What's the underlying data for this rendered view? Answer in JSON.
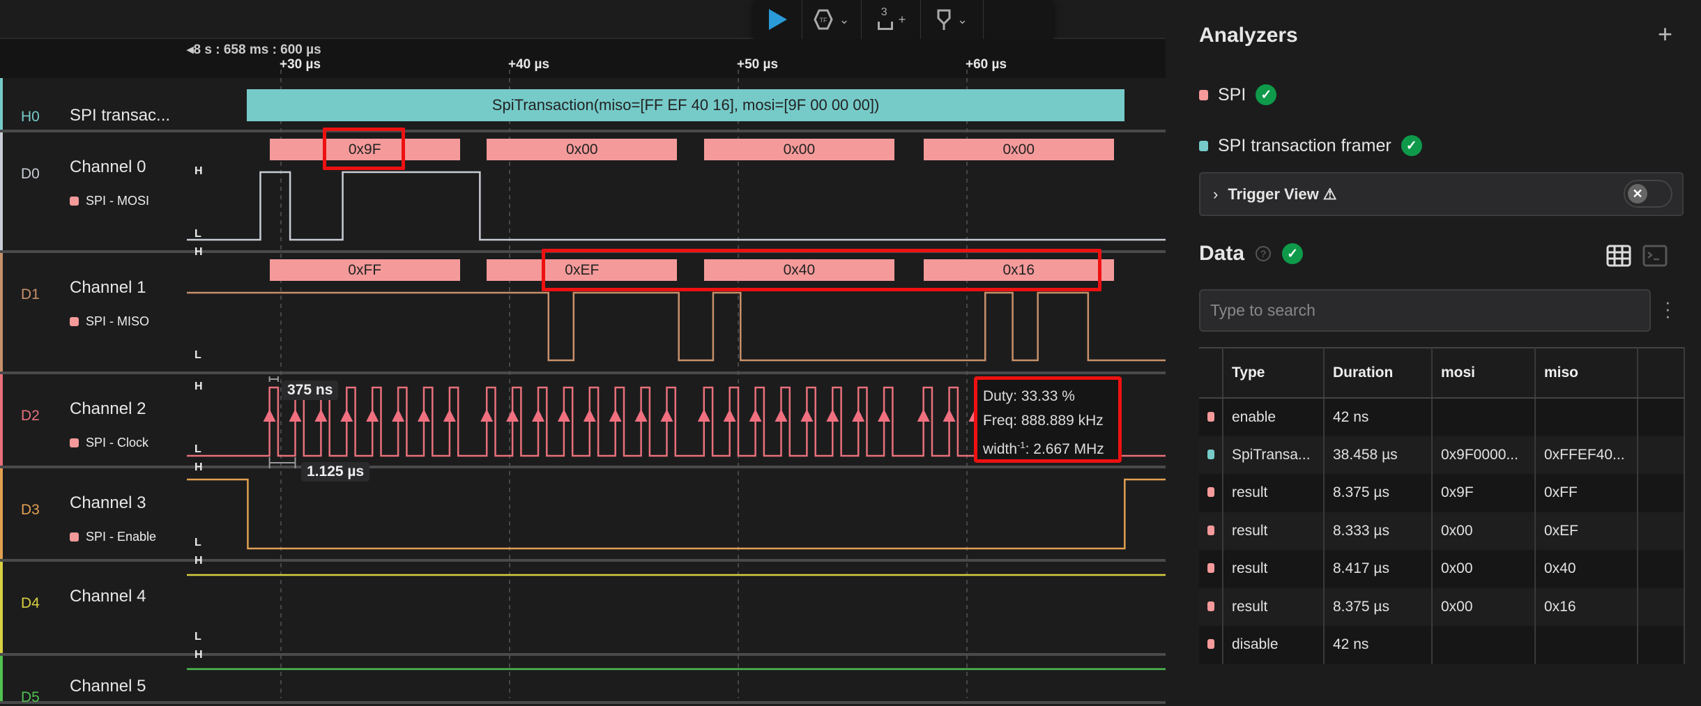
{
  "toolbar": {
    "play_icon": "play-icon",
    "trigger_icon": "trigger-icon",
    "measure_icon": "measure-icon",
    "marker_icon": "marker-icon",
    "measure_count": "3",
    "plus": "+",
    "chev": "⌄"
  },
  "ruler": {
    "origin_label": "8 s : 658 ms : 600 µs",
    "ticks": [
      {
        "t_us": 30,
        "label": "+30 µs"
      },
      {
        "t_us": 40,
        "label": "+40 µs"
      },
      {
        "t_us": 50,
        "label": "+50 µs"
      },
      {
        "t_us": 60,
        "label": "+60 µs"
      }
    ]
  },
  "channels": [
    {
      "id": "H0",
      "name": "SPI transac...",
      "color": "#76cbc9",
      "analyzer": ""
    },
    {
      "id": "D0",
      "name": "Channel 0",
      "color": "#c8ccd4",
      "analyzer": "SPI - MOSI",
      "analyzer_color": "#f59a9a"
    },
    {
      "id": "D1",
      "name": "Channel 1",
      "color": "#c8906a",
      "analyzer": "SPI - MISO",
      "analyzer_color": "#f59a9a"
    },
    {
      "id": "D2",
      "name": "Channel 2",
      "color": "#e8707a",
      "analyzer": "SPI - Clock",
      "analyzer_color": "#f59a9a"
    },
    {
      "id": "D3",
      "name": "Channel 3",
      "color": "#e0a050",
      "analyzer": "SPI - Enable",
      "analyzer_color": "#f59a9a"
    },
    {
      "id": "D4",
      "name": "Channel 4",
      "color": "#d8d040",
      "analyzer": ""
    },
    {
      "id": "D5",
      "name": "Channel 5",
      "color": "#50c050",
      "analyzer": ""
    }
  ],
  "level_labels": {
    "high": "H",
    "low": "L"
  },
  "transaction": {
    "label": "SpiTransaction(miso=[FF EF 40 16], mosi=[9F 00 00 00])",
    "start_us": 28.5,
    "end_us": 66.9
  },
  "bytes": {
    "start_us": [
      29.5,
      39.0,
      48.5,
      58.1
    ],
    "duration_us": 8.33,
    "mosi": [
      "0x9F",
      "0x00",
      "0x00",
      "0x00"
    ],
    "miso": [
      "0xFF",
      "0xEF",
      "0x40",
      "0x16"
    ]
  },
  "waveforms": {
    "D0": {
      "initial": 0,
      "toggles_us": [
        29.1,
        30.4,
        32.7,
        38.7
      ]
    },
    "D1": {
      "initial": 1,
      "toggles_us": [
        41.7,
        42.8,
        47.4,
        48.9,
        50.1,
        60.8,
        62.0,
        63.1,
        65.3
      ]
    },
    "D2": {
      "initial": 0,
      "clock_period_us": 1.125,
      "high_ns": 375
    },
    "D3": {
      "initial": 1,
      "toggles_us": [
        28.55,
        66.9
      ]
    },
    "D4": {
      "initial": 1,
      "toggles_us": []
    },
    "D5": {
      "initial": 1,
      "toggles_us": []
    }
  },
  "measurement": {
    "width": "375 ns",
    "period": "1.125 µs"
  },
  "tooltip": {
    "duty": "Duty: 33.33 %",
    "freq": "Freq: 888.889 kHz",
    "width_prefix": "width",
    "width_sup": "-1",
    "width_value": ": 2.667 MHz"
  },
  "panel": {
    "analyzers_title": "Analyzers",
    "add": "+",
    "analyzers": [
      {
        "name": "SPI",
        "color": "#f59a9a",
        "status": "ok"
      },
      {
        "name": "SPI transaction framer",
        "color": "#76cbc9",
        "status": "ok"
      }
    ],
    "trigger_view": "Trigger View",
    "trigger_warning": "⚠",
    "data_title": "Data",
    "search_placeholder": "Type to search",
    "columns": [
      "Type",
      "Duration",
      "mosi",
      "miso"
    ],
    "rows": [
      {
        "color": "#f59a9a",
        "type": "enable",
        "duration": "42 ns",
        "mosi": "",
        "miso": ""
      },
      {
        "color": "#76cbc9",
        "type": "SpiTransa...",
        "duration": "38.458 µs",
        "mosi": "0x9F0000...",
        "miso": "0xFFEF40..."
      },
      {
        "color": "#f59a9a",
        "type": "result",
        "duration": "8.375 µs",
        "mosi": "0x9F",
        "miso": "0xFF"
      },
      {
        "color": "#f59a9a",
        "type": "result",
        "duration": "8.333 µs",
        "mosi": "0x00",
        "miso": "0xEF"
      },
      {
        "color": "#f59a9a",
        "type": "result",
        "duration": "8.417 µs",
        "mosi": "0x00",
        "miso": "0x40"
      },
      {
        "color": "#f59a9a",
        "type": "result",
        "duration": "8.375 µs",
        "mosi": "0x00",
        "miso": "0x16"
      },
      {
        "color": "#f59a9a",
        "type": "disable",
        "duration": "42 ns",
        "mosi": "",
        "miso": ""
      }
    ]
  }
}
